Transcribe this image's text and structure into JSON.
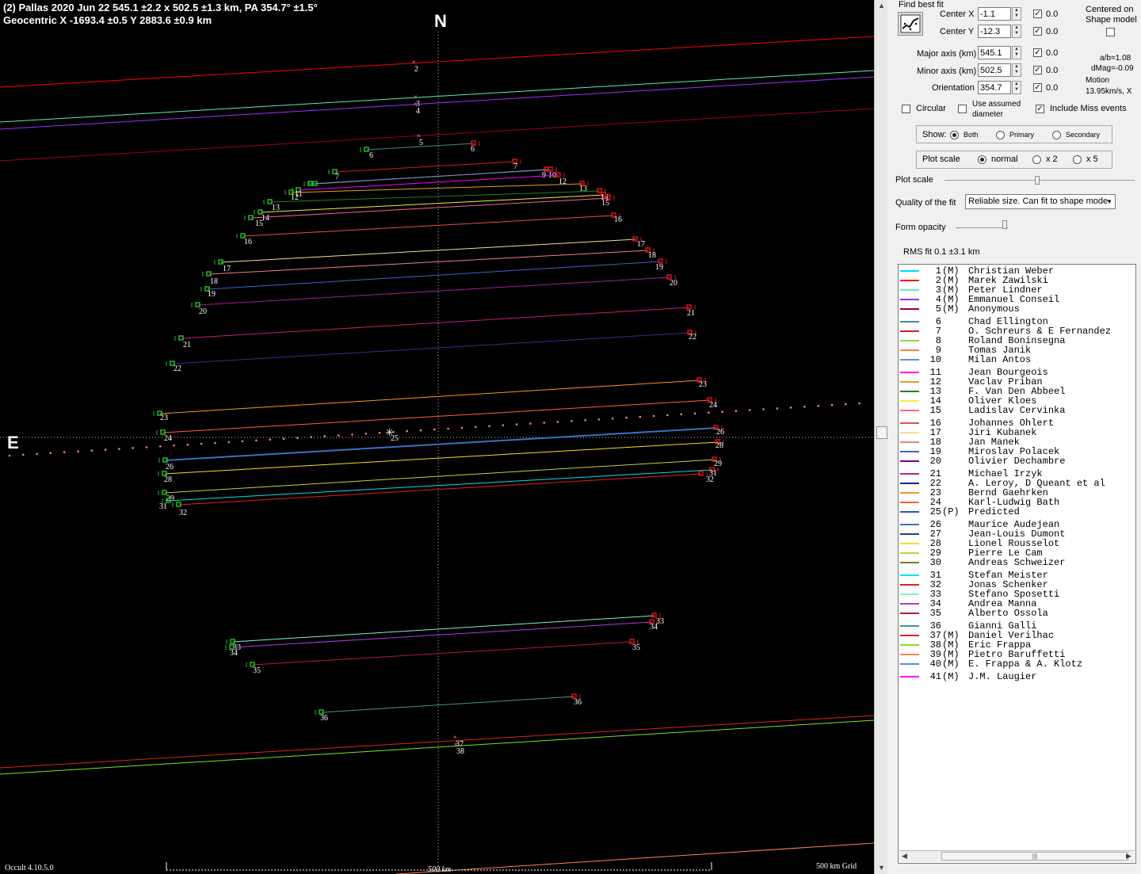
{
  "header": {
    "line1": "(2) Pallas  2020 Jun 22   545.1 ±2.2 x 502.5 ±1.3 km,  PA 354.7° ±1.5°",
    "line2": "Geocentric  X  -1693.4 ±0.5  Y 2883.6 ±0.9 km"
  },
  "compass": {
    "north": "N",
    "east": "E"
  },
  "footer": {
    "version": "Occult 4.10.5.0",
    "scale_label": "500 km",
    "grid_label": "500 km Grid"
  },
  "colors": {
    "background": "#000000",
    "panel": "#f0f0f0",
    "grid": "#bbbbbb",
    "start_marker": "#22bb22",
    "end_marker": "#dd1111",
    "path_dots": "#ff7f7f"
  },
  "panel": {
    "find_best_fit": "Find best fit",
    "fit_icon": "chart-fit-icon",
    "centered_on": "Centered on",
    "shape_model": "Shape model",
    "center_x": {
      "label": "Center X",
      "value": "-1.1",
      "offset": "0.0"
    },
    "center_y": {
      "label": "Center Y",
      "value": "-12.3",
      "offset": "0.0"
    },
    "major_axis": {
      "label": "Major axis (km)",
      "value": "545.1",
      "offset": "0.0"
    },
    "minor_axis": {
      "label": "Minor axis (km)",
      "value": "502.5",
      "offset": "0.0"
    },
    "orientation": {
      "label": "Orientation",
      "value": "354.7",
      "offset": "0.0"
    },
    "ab_ratio": "a/b=1.08",
    "dmag": "dMag=-0.09",
    "motion_label": "Motion",
    "motion_value": "13.95km/s, X",
    "circular": "Circular",
    "assumed_diameter_1": "Use assumed",
    "assumed_diameter_2": "diameter",
    "include_miss": "Include Miss events",
    "show_label": "Show:",
    "show_both": "Both",
    "show_primary": "Primary",
    "show_secondary": "Secondary",
    "plot_scale_group": "Plot scale",
    "scale_normal": "normal",
    "scale_x2": "x 2",
    "scale_x5": "x 5",
    "plot_scale_slider": "Plot scale",
    "quality_label": "Quality of the fit",
    "quality_value": "Reliable size. Can fit to shape mode",
    "form_opacity": "Form opacity",
    "rms": "RMS fit 0.1 ±3.1 km"
  },
  "observers": [
    {
      "num": "1",
      "flag": "(M)",
      "name": "Christian Weber",
      "color": "#00d8ff"
    },
    {
      "num": "2",
      "flag": "(M)",
      "name": "Marek Zawilski",
      "color": "#ff0000"
    },
    {
      "num": "3",
      "flag": "(M)",
      "name": "Peter Lindner",
      "color": "#60e8c0"
    },
    {
      "num": "4",
      "flag": "(M)",
      "name": "Emmanuel Conseil",
      "color": "#9b30ff"
    },
    {
      "num": "5",
      "flag": "(M)",
      "name": "Anonymous",
      "color": "#a00020"
    },
    {
      "num": "6",
      "flag": "",
      "name": "Chad Ellington",
      "color": "#3c8c8c"
    },
    {
      "num": "7",
      "flag": "",
      "name": "O. Schreurs & E Fernandez",
      "color": "#cc2020"
    },
    {
      "num": "8",
      "flag": "",
      "name": "Roland Boninsegna",
      "color": "#80e040"
    },
    {
      "num": "9",
      "flag": "",
      "name": "Tomas Janik",
      "color": "#ff8040"
    },
    {
      "num": "10",
      "flag": "",
      "name": "Milan Antos",
      "color": "#6090d0"
    },
    {
      "num": "11",
      "flag": "",
      "name": "Jean Bourgeois",
      "color": "#ff00ff"
    },
    {
      "num": "12",
      "flag": "",
      "name": "Vaclav Priban",
      "color": "#e0a020"
    },
    {
      "num": "13",
      "flag": "",
      "name": "F. Van Den Abbeel",
      "color": "#208020"
    },
    {
      "num": "14",
      "flag": "",
      "name": "Oliver Kloes",
      "color": "#f0f040"
    },
    {
      "num": "15",
      "flag": "",
      "name": "Ladislav Cervinka",
      "color": "#ff6090"
    },
    {
      "num": "16",
      "flag": "",
      "name": "Johannes Ohlert",
      "color": "#e05050"
    },
    {
      "num": "17",
      "flag": "",
      "name": "Jiri Kubanek",
      "color": "#f0e090"
    },
    {
      "num": "18",
      "flag": "",
      "name": "Jan Manek",
      "color": "#f08080"
    },
    {
      "num": "19",
      "flag": "",
      "name": "Miroslav Polacek",
      "color": "#4060d0"
    },
    {
      "num": "20",
      "flag": "",
      "name": "Olivier Dechambre",
      "color": "#800080"
    },
    {
      "num": "21",
      "flag": "",
      "name": "Michael Irzyk",
      "color": "#c02080"
    },
    {
      "num": "22",
      "flag": "",
      "name": "A. Leroy, D Queant et al",
      "color": "#202080"
    },
    {
      "num": "23",
      "flag": "",
      "name": "Bernd Gaehrken",
      "color": "#ff9020"
    },
    {
      "num": "24",
      "flag": "",
      "name": "Karl-Ludwig Bath",
      "color": "#ff6030"
    },
    {
      "num": "25",
      "flag": "(P)",
      "name": "Predicted",
      "color": "#3050c0"
    },
    {
      "num": "26",
      "flag": "",
      "name": "Maurice Audejean",
      "color": "#3a70c0"
    },
    {
      "num": "27",
      "flag": "",
      "name": "Jean-Louis Dumont",
      "color": "#2a3a80"
    },
    {
      "num": "28",
      "flag": "",
      "name": "Lionel Rousselot",
      "color": "#f0e020"
    },
    {
      "num": "29",
      "flag": "",
      "name": "Pierre Le Cam",
      "color": "#c0d040"
    },
    {
      "num": "30",
      "flag": "",
      "name": "Andreas Schweizer",
      "color": "#708010"
    },
    {
      "num": "31",
      "flag": "",
      "name": "Stefan Meister",
      "color": "#00e0f0"
    },
    {
      "num": "32",
      "flag": "",
      "name": "Jonas Schenker",
      "color": "#e02020"
    },
    {
      "num": "33",
      "flag": "",
      "name": "Stefano Sposetti",
      "color": "#80f0d0"
    },
    {
      "num": "34",
      "flag": "",
      "name": "Andrea Manna",
      "color": "#a040e0"
    },
    {
      "num": "35",
      "flag": "",
      "name": "Alberto Ossola",
      "color": "#b02030"
    },
    {
      "num": "36",
      "flag": "",
      "name": "Gianni Galli",
      "color": "#4a9090"
    },
    {
      "num": "37",
      "flag": "(M)",
      "name": "Daniel Verilhac",
      "color": "#e02020"
    },
    {
      "num": "38",
      "flag": "(M)",
      "name": "Eric Frappa",
      "color": "#80e020"
    },
    {
      "num": "39",
      "flag": "(M)",
      "name": "Pietro Baruffetti",
      "color": "#ff8050"
    },
    {
      "num": "40",
      "flag": "(M)",
      "name": "E. Frappa & A. Klotz",
      "color": "#5090e0"
    },
    {
      "num": "41",
      "flag": "(M)",
      "name": "J.M. Laugier",
      "color": "#ff00ff"
    }
  ],
  "chords": [
    {
      "id": "2",
      "color": "#ff0000",
      "type": "miss"
    },
    {
      "id": "3",
      "color": "#60e8c0",
      "type": "miss"
    },
    {
      "id": "4",
      "color": "#9b30ff",
      "type": "miss"
    },
    {
      "id": "5",
      "color": "#a00020",
      "type": "miss"
    },
    {
      "id": "6",
      "color": "#3c8c8c",
      "type": "chord"
    },
    {
      "id": "7",
      "color": "#cc2020",
      "type": "chord"
    },
    {
      "id": "9",
      "color": "#ff8040",
      "type": "chord"
    },
    {
      "id": "10",
      "color": "#6090d0",
      "type": "chord"
    },
    {
      "id": "11",
      "color": "#ff00ff",
      "type": "chord"
    },
    {
      "id": "12",
      "color": "#e0a020",
      "type": "chord"
    },
    {
      "id": "13",
      "color": "#208020",
      "type": "chord"
    },
    {
      "id": "14",
      "color": "#f0f040",
      "type": "chord"
    },
    {
      "id": "15",
      "color": "#ff6090",
      "type": "chord"
    },
    {
      "id": "16",
      "color": "#e05050",
      "type": "chord"
    },
    {
      "id": "17",
      "color": "#f0e090",
      "type": "chord"
    },
    {
      "id": "18",
      "color": "#f08080",
      "type": "chord"
    },
    {
      "id": "19",
      "color": "#4060d0",
      "type": "chord"
    },
    {
      "id": "20",
      "color": "#a020a0",
      "type": "chord"
    },
    {
      "id": "21",
      "color": "#c02080",
      "type": "chord"
    },
    {
      "id": "22",
      "color": "#303090",
      "type": "chord"
    },
    {
      "id": "23",
      "color": "#ff9020",
      "type": "chord"
    },
    {
      "id": "24",
      "color": "#ff6030",
      "type": "chord"
    },
    {
      "id": "26",
      "color": "#3a70c0",
      "type": "chord"
    },
    {
      "id": "28",
      "color": "#f0e020",
      "type": "chord"
    },
    {
      "id": "29",
      "color": "#c0d040",
      "type": "chord"
    },
    {
      "id": "31",
      "color": "#00e0f0",
      "type": "chord"
    },
    {
      "id": "32",
      "color": "#e02020",
      "type": "chord"
    },
    {
      "id": "33",
      "color": "#80f0d0",
      "type": "chord"
    },
    {
      "id": "34",
      "color": "#a040e0",
      "type": "chord"
    },
    {
      "id": "35",
      "color": "#b02030",
      "type": "chord"
    },
    {
      "id": "36",
      "color": "#4a9090",
      "type": "chord"
    },
    {
      "id": "37",
      "color": "#e02020",
      "type": "miss"
    },
    {
      "id": "38",
      "color": "#80e020",
      "type": "miss"
    },
    {
      "id": "39",
      "color": "#ff8050",
      "type": "miss"
    }
  ]
}
